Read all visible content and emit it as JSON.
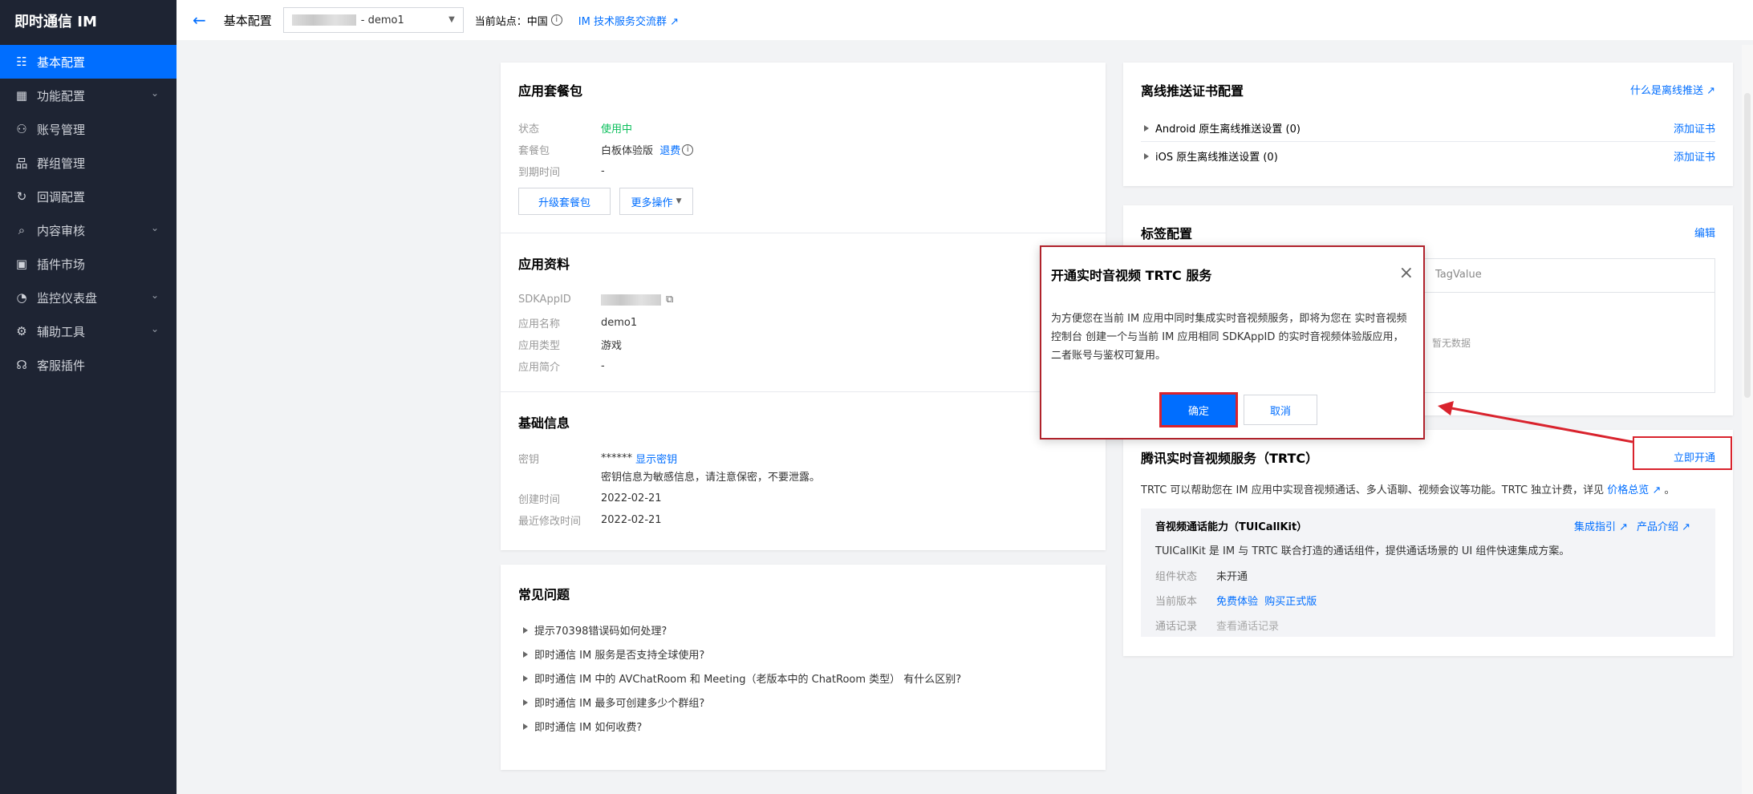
{
  "sidebar": {
    "title": "即时通信 IM",
    "items": [
      {
        "label": "基本配置",
        "icon": "sliders-icon",
        "active": true,
        "expand": false
      },
      {
        "label": "功能配置",
        "icon": "grid-icon",
        "active": false,
        "expand": true
      },
      {
        "label": "账号管理",
        "icon": "user-icon",
        "active": false,
        "expand": false
      },
      {
        "label": "群组管理",
        "icon": "org-icon",
        "active": false,
        "expand": false
      },
      {
        "label": "回调配置",
        "icon": "refresh-icon",
        "active": false,
        "expand": false
      },
      {
        "label": "内容审核",
        "icon": "search-icon",
        "active": false,
        "expand": true
      },
      {
        "label": "插件市场",
        "icon": "plugin-icon",
        "active": false,
        "expand": false
      },
      {
        "label": "监控仪表盘",
        "icon": "gauge-icon",
        "active": false,
        "expand": true
      },
      {
        "label": "辅助工具",
        "icon": "tool-icon",
        "active": false,
        "expand": true
      },
      {
        "label": "客服插件",
        "icon": "headset-icon",
        "active": false,
        "expand": false
      }
    ],
    "chevron": "⌄"
  },
  "topbar": {
    "back": "←",
    "title": "基本配置",
    "app_name": "- demo1",
    "station_label": "当前站点：中国",
    "info": "i",
    "group_link": "IM 技术服务交流群"
  },
  "package": {
    "title": "应用套餐包",
    "status_label": "状态",
    "status_value": "使用中",
    "pkg_label": "套餐包",
    "pkg_value": "白板体验版",
    "refund": "退费",
    "expire_label": "到期时间",
    "expire_value": "-",
    "upgrade": "升级套餐包",
    "more": "更多操作"
  },
  "appinfo": {
    "title": "应用资料",
    "sdk_label": "SDKAppID",
    "name_label": "应用名称",
    "name_value": "demo1",
    "type_label": "应用类型",
    "type_value": "游戏",
    "desc_label": "应用简介",
    "desc_value": "-"
  },
  "basic": {
    "title": "基础信息",
    "key_label": "密钥",
    "key_mask": "******",
    "key_show": "显示密钥",
    "key_note": "密钥信息为敏感信息，请注意保密，不要泄露。",
    "created_label": "创建时间",
    "created_value": "2022-02-21",
    "modified_label": "最近修改时间",
    "modified_value": "2022-02-21"
  },
  "faq": {
    "title": "常见问题",
    "items": [
      "提示70398错误码如何处理?",
      "即时通信 IM 服务是否支持全球使用?",
      "即时通信 IM 中的 AVChatRoom 和 Meeting（老版本中的 ChatRoom 类型） 有什么区别?",
      "即时通信 IM 最多可创建多少个群组?",
      "即时通信 IM 如何收费?"
    ]
  },
  "push": {
    "title": "离线推送证书配置",
    "help": "什么是离线推送",
    "android": "Android 原生离线推送设置 (0)",
    "ios": "iOS 原生离线推送设置 (0)",
    "add": "添加证书"
  },
  "tag": {
    "title": "标签配置",
    "edit": "编辑",
    "col": "TagValue",
    "empty": "暂无数据"
  },
  "trtc": {
    "title": "腾讯实时音视频服务（TRTC）",
    "open": "立即开通",
    "desc": "TRTC 可以帮助您在 IM 应用中实现音视频通话、多人语聊、视频会议等功能。TRTC 独立计费，详见",
    "price": "价格总览",
    "kit_title": "音视频通话能力（TUICallKit）",
    "guide": "集成指引",
    "intro": "产品介绍",
    "kit_desc": "TUICallKit 是 IM 与 TRTC 联合打造的通话组件，提供通话场景的 UI 组件快速集成方案。",
    "state_label": "组件状态",
    "state_value": "未开通",
    "version_label": "当前版本",
    "trial": "免费体验",
    "buy": "购买正式版",
    "record_label": "通话记录",
    "record_value": "查看通话记录"
  },
  "modal": {
    "title": "开通实时音视频 TRTC 服务",
    "close": "×",
    "message": "为方便您在当前 IM 应用中同时集成实时音视频服务，即将为您在 实时音视频控制台 创建一个与当前 IM 应用相同 SDKAppID 的实时音视频体验版应用，二者账号与鉴权可复用。",
    "ok": "确定",
    "cancel": "取消"
  },
  "colors": {
    "accent": "#006eff",
    "sidebar": "#1e2433",
    "highlight": "#d9232d",
    "success": "#0abf5b"
  }
}
